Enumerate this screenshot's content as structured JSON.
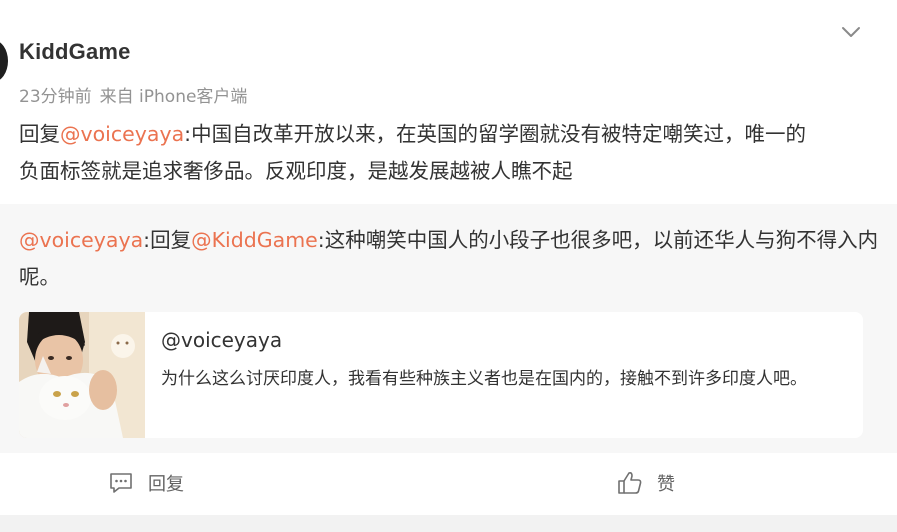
{
  "post": {
    "author": "KiddGame",
    "time": "23分钟前",
    "source": "来自 iPhone客户端",
    "reply_prefix": "回复",
    "mention": "@voiceyaya",
    "body": ":中国自改革开放以来，在英国的留学圈就没有被特定嘲笑过，唯一的负面标签就是追求奢侈品。反观印度，是越发展越被人瞧不起"
  },
  "repost": {
    "mention_author": "@voiceyaya",
    "colon": ":",
    "reply_prefix": "回复",
    "mention_target": "@KiddGame",
    "body": ":这种嘲笑中国人的小段子也很多吧，以前还华人与狗不得入内呢。",
    "quote": {
      "user": "@voiceyaya",
      "text": "为什么这么讨厌印度人，我看有些种族主义者也是在国内的，接触不到许多印度人吧。"
    }
  },
  "actions": {
    "reply_label": "回复",
    "like_label": "赞"
  },
  "icons": {
    "collapse": "chevron-down-icon",
    "reply": "comment-icon",
    "like": "thumbs-up-icon"
  },
  "colors": {
    "mention": "#eb7350",
    "meta": "#939393",
    "repost_bg": "#f7f7f7"
  }
}
